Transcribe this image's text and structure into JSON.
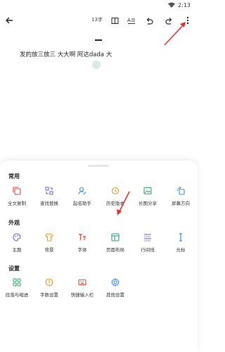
{
  "status": {
    "time": "2:13"
  },
  "toolbar": {
    "word_count": "13字"
  },
  "editor": {
    "text": "发的放三放三 大大啊 阿达dada  大"
  },
  "sheet": {
    "sections": [
      {
        "title": "常用",
        "items": [
          "全文复制",
          "查找替换",
          "起名助手",
          "历史版本",
          "长图分享",
          "屏幕方向"
        ]
      },
      {
        "title": "外观",
        "items": [
          "主题",
          "背景",
          "字体",
          "页面布局",
          "行间线",
          "光标"
        ]
      },
      {
        "title": "设置",
        "items": [
          "段落与缩进",
          "字数设置",
          "快捷输入栏",
          "其他设置"
        ]
      }
    ]
  },
  "colors": {
    "arrow_red": "#e0322a",
    "icon_red": "#e0483c",
    "icon_purple": "#6f66d9",
    "icon_blue": "#3f88e8",
    "icon_orange": "#f09a2a",
    "icon_green": "#3aa46a",
    "icon_teal": "#2d9f84"
  }
}
